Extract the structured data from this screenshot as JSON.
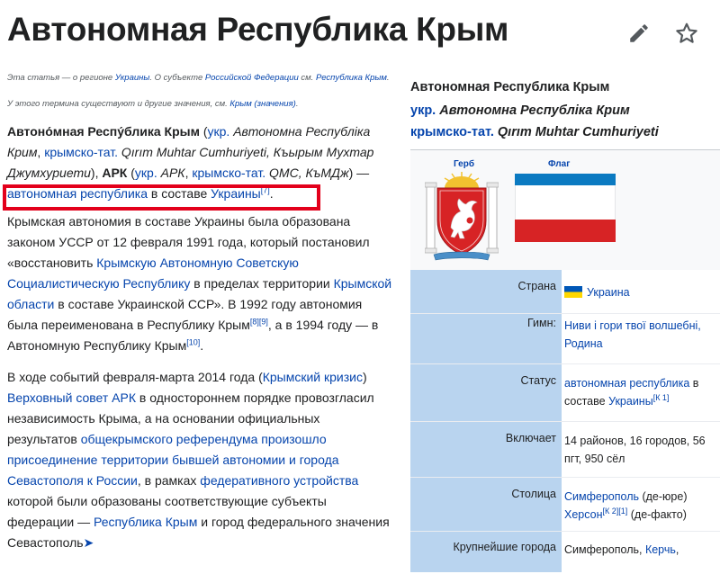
{
  "header": {
    "title": "Автономная Республика Крым",
    "edit_icon": "pencil-icon",
    "watch_icon": "star-icon"
  },
  "hatnotes": {
    "first": {
      "pre": "Эта статья — о регионе ",
      "link1": "Украины",
      "mid": ". О субъекте ",
      "link2": "Российской Федерации",
      "mid2": " см. ",
      "link3": "Республика Крым",
      "post": "."
    },
    "second": {
      "pre": "У этого термина существуют и другие значения, см. ",
      "link": "Крым (значения)",
      "post": "."
    }
  },
  "paragraph1": {
    "bold1": "Автоно́мная Респу́блика Крым",
    "t1": " (",
    "link_ukr": "укр.",
    "it1": " Автономна Республіка Крим",
    "t2": ", ",
    "link_crt": "крымско-тат.",
    "it2": " Qırım Muhtar Cumhuriyeti, Къырым Мухтар Джумхуриети",
    "t3": "), ",
    "bold2": "АРК",
    "t4": " (",
    "link_ukr2": "укр.",
    "it3": " АРК",
    "t5": ", ",
    "link_crt2": "крымско-тат.",
    "it4": " QMC, КъМДж",
    "t6": ") — ",
    "link_ar": "автономная республика",
    "t7": " в составе ",
    "link_ua": "Украины",
    "ref": "[7]",
    "t8": "."
  },
  "paragraph2": {
    "t1": "Крымская автономия в составе Украины была образована законом УССР от 12 февраля 1991 года, который постановил «восстановить ",
    "link1": "Крымскую Автономную Советскую Социалистическую Республику",
    "t2": " в пределах территории ",
    "link2": "Крымской области",
    "t3": " в составе Украинской ССР». В 1992 году автономия была переименована в Республику Крым",
    "ref1": "[8]",
    "ref2": "[9]",
    "t4": ", а в 1994 году — в Автономную Республику Крым",
    "ref3": "[10]",
    "t5": "."
  },
  "paragraph3": {
    "t1": "В ходе событий февраля-марта 2014 года (",
    "link1": "Крымский кризис",
    "t2": ") ",
    "link2": "Верховный совет АРК",
    "t3": " в одностороннем порядке провозгласил независимость Крыма, а на основании официальных результатов ",
    "link3": "общекрымского референдума",
    "t4": " ",
    "link4": "произошло присоединение территории бывшей автономии и города Севастополя к России",
    "t5": ", в рамках ",
    "link5": "федеративного устройства",
    "t6": " которой были образованы соответствующие субъекты федерации — ",
    "link6": "Республика Крым",
    "t7": " и город федерального значения Севастополь",
    "more": "➤"
  },
  "infobox": {
    "title": "Автономная Республика Крым",
    "ukr_label": "укр.",
    "ukr_name": " Автономна Республіка Крим",
    "crt_label": "крымско-тат.",
    "crt_name": " Qırım Muhtar Cumhuriyeti",
    "coat_caption": "Герб",
    "flag_caption": "Флаг",
    "rows": {
      "country": {
        "label": "Страна",
        "value": "Украина"
      },
      "anthem": {
        "label": "Гимн:",
        "value": "Ниви і гори твої волшебні, Родина"
      },
      "status": {
        "label": "Статус",
        "link": "автономная республика",
        "t1": " в составе ",
        "link2": "Украины",
        "ref": "[К 1]"
      },
      "includes": {
        "label": "Включает",
        "value": "14 районов, 16 городов, 56 пгт, 950 сёл"
      },
      "capital": {
        "label": "Столица",
        "link1": "Симферополь",
        "t1": " (де-юре)",
        "link2": "Херсон",
        "ref": "[К 2][1]",
        "t2": " (де-факто)"
      },
      "cities": {
        "label": "Крупнейшие города",
        "t1": "Симферополь, ",
        "link1": "Керчь",
        "t2": ","
      }
    }
  },
  "colors": {
    "highlight_box": "#e3001b",
    "link": "#0645ad",
    "infobox_label_bg": "#b9d4ef",
    "flag_blue": "#0b7ac1",
    "flag_red": "#d72325"
  }
}
